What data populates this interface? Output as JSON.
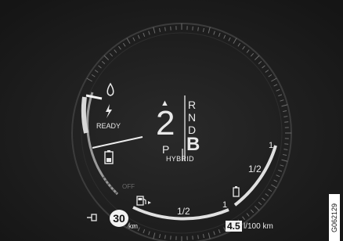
{
  "colors": {
    "background": "#1b1b1b",
    "text": "#e9e9e9",
    "dim": "#6a6a6a",
    "badge": "#f2f2f2"
  },
  "gear": {
    "current": "2",
    "p_label": "P",
    "selector": [
      "R",
      "N",
      "D",
      "B"
    ],
    "selected": "B",
    "up_arrow": "▲"
  },
  "mode_label": "HYBRID",
  "power_gauge": {
    "ready_label": "READY",
    "off_label": "OFF"
  },
  "speed": {
    "value": "30",
    "unit": "km"
  },
  "consumption": {
    "value": "4.5",
    "unit": "l/100 km"
  },
  "fuel_gauge": {
    "half_label": "1/2",
    "full_mark": "1"
  },
  "battery_gauge": {
    "half_label": "1/2",
    "full_mark": "1"
  },
  "image_code": "G062129",
  "icons": [
    "drop-icon",
    "lightning-icon",
    "battery-icon",
    "fuel-pump-icon",
    "charge-plug-icon",
    "battery-small-icon"
  ]
}
